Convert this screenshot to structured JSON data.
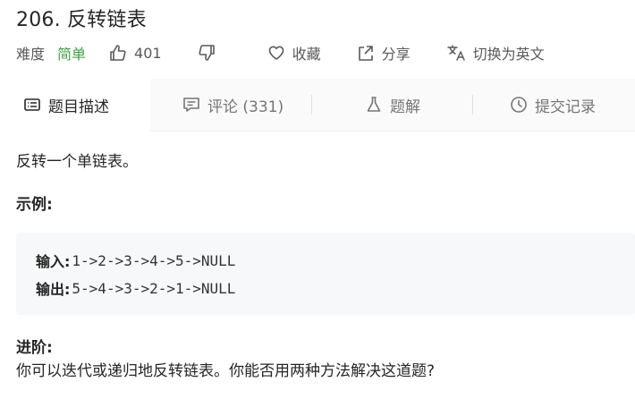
{
  "problem": {
    "title": "206. 反转链表",
    "difficulty_label": "难度",
    "difficulty": "简单",
    "likes": "401",
    "favorite_label": "收藏",
    "share_label": "分享",
    "switch_lang_label": "切换为英文"
  },
  "tabs": [
    {
      "label": "题目描述",
      "icon": "description-icon",
      "active": true
    },
    {
      "label": "评论 (331)",
      "icon": "comment-icon",
      "active": false
    },
    {
      "label": "题解",
      "icon": "flask-icon",
      "active": false
    },
    {
      "label": "提交记录",
      "icon": "clock-icon",
      "active": false
    }
  ],
  "content": {
    "description": "反转一个单链表。",
    "example_title": "示例:",
    "input_label": "输入:",
    "input_value": "1->2->3->4->5->NULL",
    "output_label": "输出:",
    "output_value": "5->4->3->2->1->NULL",
    "advanced_title": "进阶:",
    "advanced_text": "你可以迭代或递归地反转链表。你能否用两种方法解决这道题?"
  },
  "colors": {
    "difficulty_easy": "#43a047",
    "tab_bar_bg": "#fafafa",
    "code_bg": "#f7f8fa"
  }
}
